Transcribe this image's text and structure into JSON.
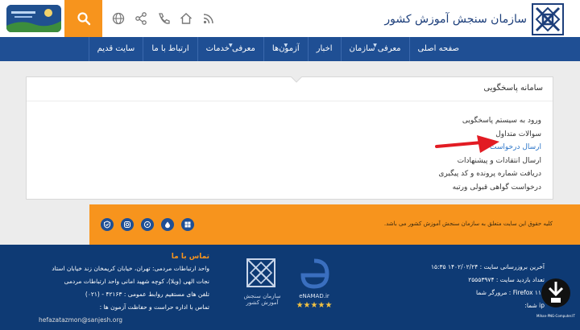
{
  "header": {
    "logo_text": "سازمان سنجش آموزش کشور",
    "icons": [
      "rss-icon",
      "home-icon",
      "phone-icon",
      "share-icon",
      "globe-icon"
    ],
    "search_icon": "search-icon",
    "badge_text": ""
  },
  "nav": {
    "items": [
      {
        "label": "صفحه اصلی",
        "dropdown": false
      },
      {
        "label": "معرفی سازمان",
        "dropdown": true
      },
      {
        "label": "اخبار",
        "dropdown": false
      },
      {
        "label": "آزمون‌ها",
        "dropdown": true
      },
      {
        "label": "معرفی خدمات",
        "dropdown": true
      },
      {
        "label": "ارتباط با ما",
        "dropdown": false
      },
      {
        "label": "سایت قدیم",
        "dropdown": false
      }
    ]
  },
  "panel": {
    "title": "سامانه پاسخگویی",
    "items": [
      {
        "label": "ورود به سیستم پاسخگویی",
        "active": false
      },
      {
        "label": "سوالات متداول",
        "active": false
      },
      {
        "label": "ارسال درخواست",
        "active": true
      },
      {
        "label": "ارسال انتقادات و پیشنهادات",
        "active": false
      },
      {
        "label": "دریافت شماره پرونده و کد پیگیری",
        "active": false
      },
      {
        "label": "درخواست گواهی قبولی ورتبه",
        "active": false
      }
    ]
  },
  "band": {
    "copyright": "کلیه حقوق این سایت متعلق به سازمان سنجش آموزش کشور می باشد.",
    "socials": [
      "windows-icon",
      "drop-icon",
      "compass-icon",
      "instagram-icon",
      "shield-check-icon"
    ]
  },
  "footer": {
    "contact_title": "تماس با ما",
    "contact_lines": [
      "واحد ارتباطات مردمی: تهران، خیابان کریمخان زند خیابان استاد",
      "نجات الهی (ویلا)، کوچه شهید امانی واحد ارتباطات مردمی",
      "تلفن های مستقیم روابط عمومی : ۴۲۱۶۳ - (۰۲۱)",
      "تماس با اداره حراست و حفاظت آزمون ها :"
    ],
    "email": "hefazatazmon@sanjesh.org",
    "stats": [
      "آخرین بروزرسانی سایت : ۱۴۰۲/۰۲/۲۴ ۱۵:۳۵",
      "تعداد بازدید سایت : ۲۵۵۵۳۹۷۴",
      "Firefox ۱۱۲ : مرورگر شما",
      "ip شما:"
    ],
    "enamad_text": "eNAMAD.ir",
    "enamad_stars": "★★★★★",
    "logo_text": "سازمان سنجش آموزش کشور",
    "corner_text": "Mihan-PNG-Computer.IT"
  },
  "colors": {
    "orange": "#f7941d",
    "navy": "#1f4f94",
    "footer": "#0e3a74",
    "arrow": "#e21b23",
    "active_link": "#2a74c8"
  }
}
